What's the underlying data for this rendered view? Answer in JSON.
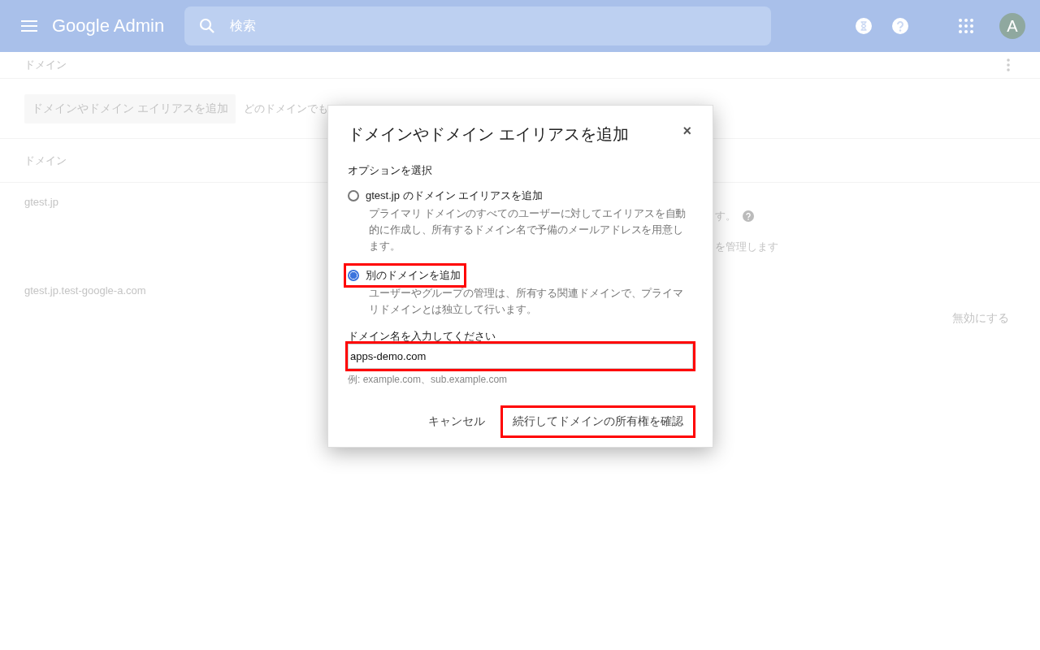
{
  "header": {
    "logo": "Google Admin",
    "search": {
      "placeholder": "検索"
    },
    "avatar": "A"
  },
  "page": {
    "title": "ドメイン",
    "add_button": "ドメインやドメイン エイリアスを追加",
    "toolbar_text": "どのドメインでも",
    "columns": [
      "ドメイン"
    ],
    "rows": [
      {
        "domain": "gtest.jp",
        "fragments": [
          {
            "text": "す。",
            "help": true
          },
          {
            "text": "を管理します",
            "help": false
          }
        ]
      },
      {
        "domain": "gtest.jp.test-google-a.com",
        "fragments": [],
        "action": "無効にする"
      }
    ]
  },
  "dialog": {
    "title": "ドメインやドメイン エイリアスを追加",
    "close": "×",
    "section_label": "オプションを選択",
    "options": [
      {
        "label": "gtest.jp のドメイン エイリアスを追加",
        "description": "プライマリ ドメインのすべてのユーザーに対してエイリアスを自動的に作成し、所有するドメイン名で予備のメールアドレスを用意します。",
        "selected": false,
        "highlighted": false
      },
      {
        "label": "別のドメインを追加",
        "description": "ユーザーやグループの管理は、所有する関連ドメインで、プライマリドメインとは独立して行います。",
        "selected": true,
        "highlighted": true
      }
    ],
    "field": {
      "label": "ドメイン名を入力してください",
      "value": "apps-demo.com",
      "hint": "例: example.com、sub.example.com",
      "highlighted": true
    },
    "buttons": [
      {
        "label": "キャンセル",
        "highlighted": false
      },
      {
        "label": "続行してドメインの所有権を確認",
        "highlighted": true
      }
    ]
  }
}
